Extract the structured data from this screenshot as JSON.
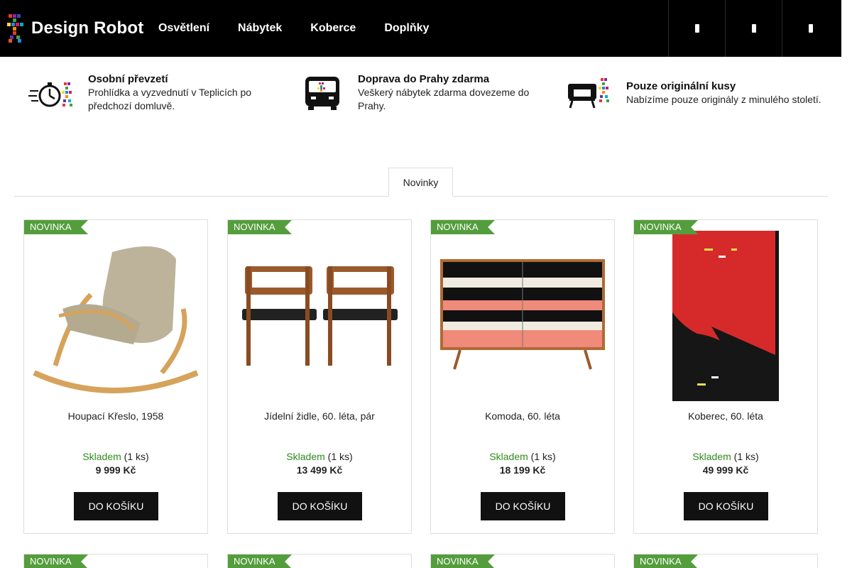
{
  "header": {
    "logo_text": "Design Robot",
    "nav": [
      "Osvětlení",
      "Nábytek",
      "Koberce",
      "Doplňky"
    ],
    "icons": [
      "search-icon",
      "user-icon",
      "cart-icon"
    ]
  },
  "benefits": [
    {
      "title": "Osobní převzetí",
      "text": "Prohlídka a vyzvednutí v Teplicích po předchozí domluvě.",
      "icon": "stopwatch-icon"
    },
    {
      "title": "Doprava do Prahy zdarma",
      "text": "Veškerý nábytek zdarma dovezeme do Prahy.",
      "icon": "van-icon"
    },
    {
      "title": "Pouze originální kusy",
      "text": "Nabízíme pouze originály z minulého století.",
      "icon": "armchair-icon"
    }
  ],
  "tabs": {
    "active": "Novinky"
  },
  "products": [
    {
      "badge": "NOVINKA",
      "name": "Houpací Křeslo, 1958",
      "stock_label": "Skladem",
      "stock_qty": "(1 ks)",
      "price": "9 999 Kč",
      "button": "DO KOŠÍKU"
    },
    {
      "badge": "NOVINKA",
      "name": "Jídelní židle, 60. léta, pár",
      "stock_label": "Skladem",
      "stock_qty": "(1 ks)",
      "price": "13 499 Kč",
      "button": "DO KOŠÍKU"
    },
    {
      "badge": "NOVINKA",
      "name": "Komoda, 60. léta",
      "stock_label": "Skladem",
      "stock_qty": "(1 ks)",
      "price": "18 199 Kč",
      "button": "DO KOŠÍKU"
    },
    {
      "badge": "NOVINKA",
      "name": "Koberec, 60. léta",
      "stock_label": "Skladem",
      "stock_qty": "(1 ks)",
      "price": "49 999 Kč",
      "button": "DO KOŠÍKU"
    }
  ],
  "next_row_badges": [
    "NOVINKA",
    "NOVINKA",
    "NOVINKA",
    "NOVINKA"
  ],
  "colors": {
    "header_bg": "#000000",
    "badge_green": "#549d3c",
    "stock_green": "#2e8b1e",
    "button_bg": "#111111"
  }
}
